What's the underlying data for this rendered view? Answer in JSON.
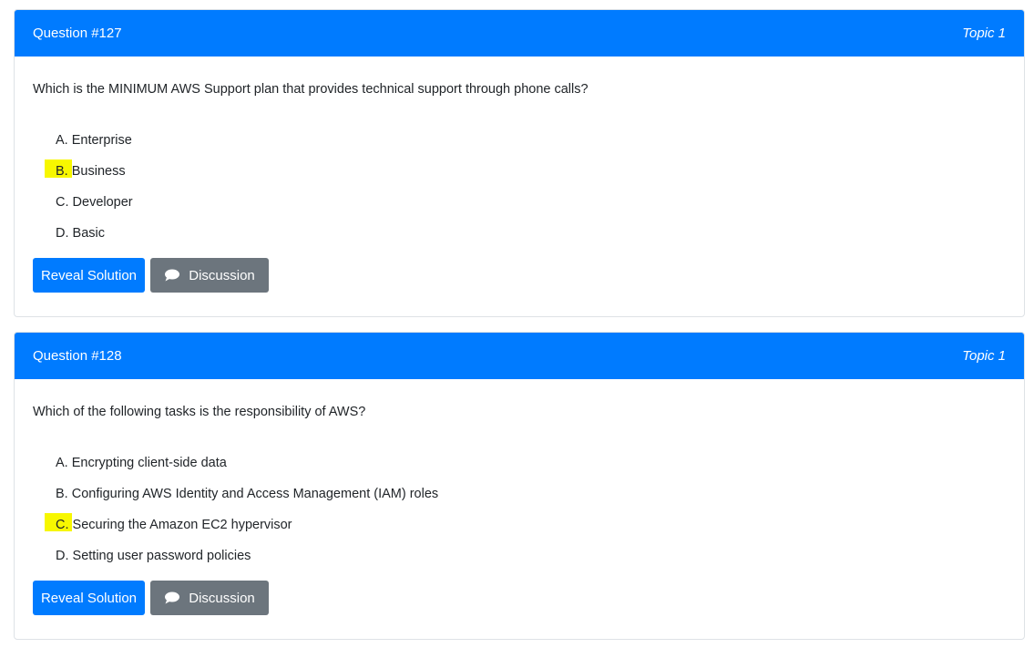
{
  "questions": [
    {
      "header": "Question #127",
      "topic": "Topic 1",
      "text": "Which is the MINIMUM AWS Support plan that provides technical support through phone calls?",
      "choices": [
        {
          "letter": "A.",
          "text": " Enterprise",
          "highlighted": false
        },
        {
          "letter": "B.",
          "text": " Business",
          "highlighted": true
        },
        {
          "letter": "C.",
          "text": " Developer",
          "highlighted": false
        },
        {
          "letter": "D.",
          "text": " Basic",
          "highlighted": false
        }
      ],
      "reveal_label": "Reveal Solution",
      "discussion_label": "Discussion"
    },
    {
      "header": "Question #128",
      "topic": "Topic 1",
      "text": "Which of the following tasks is the responsibility of AWS?",
      "choices": [
        {
          "letter": "A.",
          "text": " Encrypting client-side data",
          "highlighted": false
        },
        {
          "letter": "B.",
          "text": " Configuring AWS Identity and Access Management (IAM) roles",
          "highlighted": false
        },
        {
          "letter": "C.",
          "text": " Securing the Amazon EC2 hypervisor",
          "highlighted": true
        },
        {
          "letter": "D.",
          "text": " Setting user password policies",
          "highlighted": false
        }
      ],
      "reveal_label": "Reveal Solution",
      "discussion_label": "Discussion"
    }
  ],
  "colors": {
    "header_bg": "#007bff",
    "reveal_bg": "#007bff",
    "discussion_bg": "#6c757d",
    "highlight": "#f7f700"
  },
  "icons": {
    "discussion": "chat-bubble-icon"
  }
}
